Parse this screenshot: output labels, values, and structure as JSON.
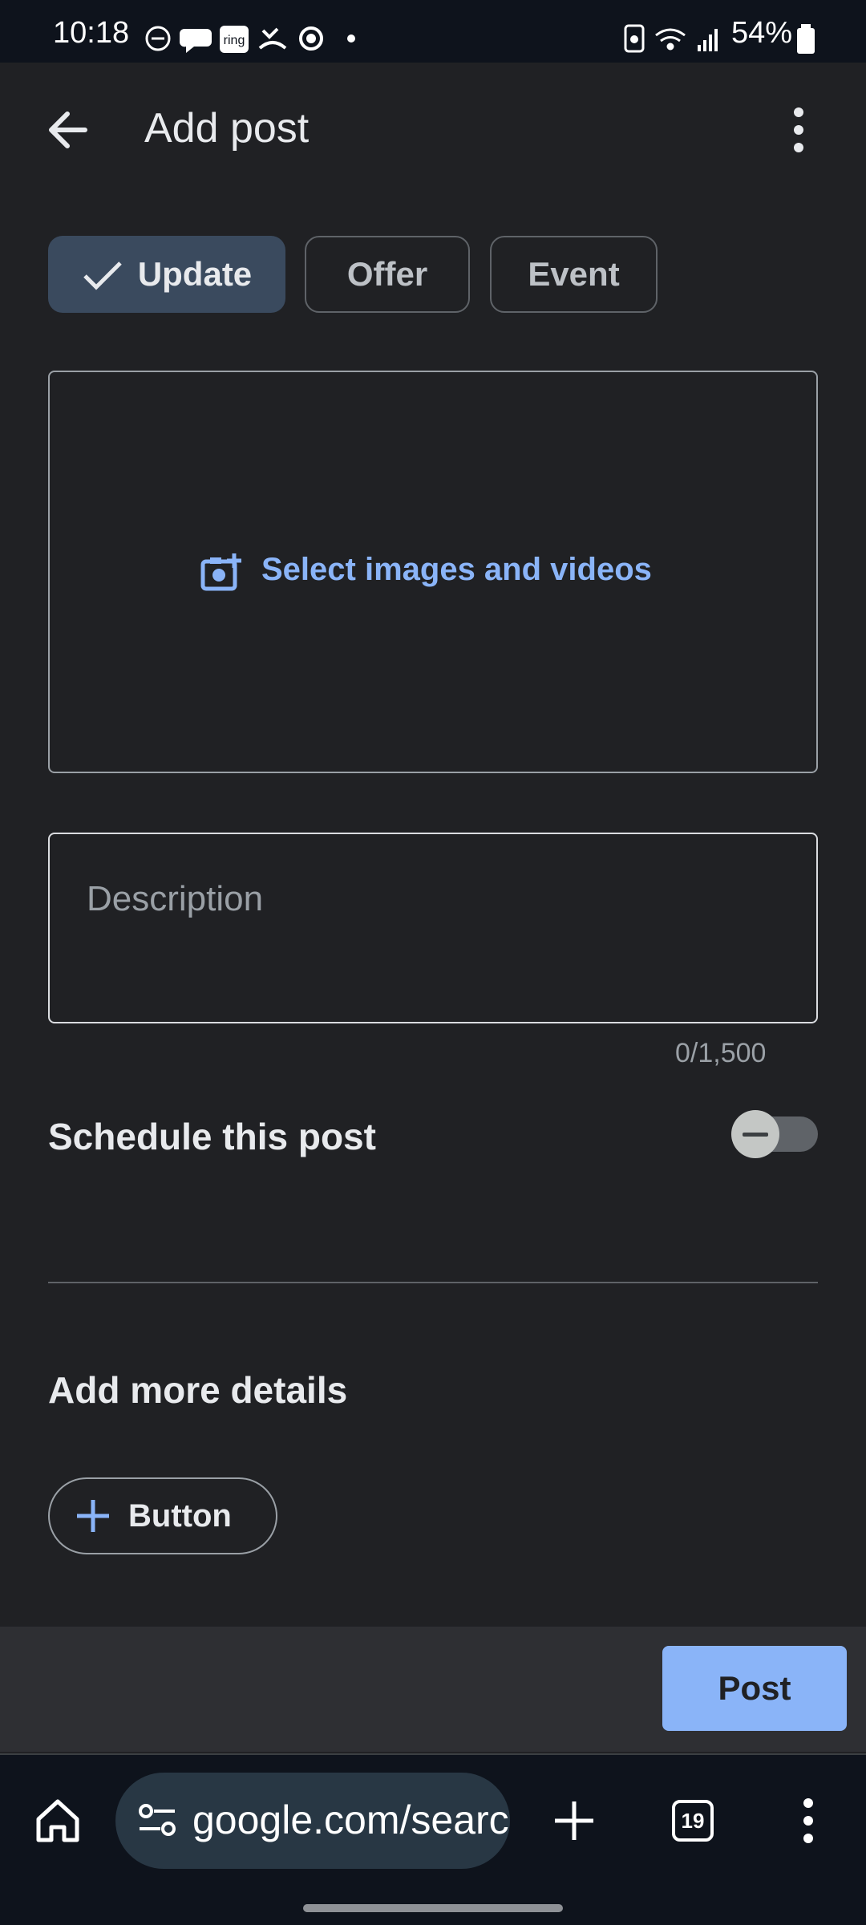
{
  "status_bar": {
    "time": "10:18",
    "battery": "54%",
    "icons": [
      "do-not-disturb-icon",
      "chat-icon",
      "ring-icon",
      "missed-call-icon",
      "sync-icon",
      "dot-icon",
      "battery-saver-icon",
      "wifi-icon",
      "signal-icon",
      "battery-icon"
    ],
    "ring_label": "ring"
  },
  "app_bar": {
    "title": "Add post"
  },
  "post_types": {
    "selected": "Update",
    "chips": [
      "Update",
      "Offer",
      "Event"
    ]
  },
  "media": {
    "label": "Select images and videos"
  },
  "description": {
    "placeholder": "Description",
    "counter": "0/1,500"
  },
  "schedule": {
    "label": "Schedule this post",
    "enabled": false
  },
  "details": {
    "heading": "Add more details",
    "button_label": "Button"
  },
  "actions": {
    "post_label": "Post"
  },
  "browser": {
    "url": "google.com/search",
    "tab_count": "19"
  },
  "colors": {
    "accent": "#8ab4f8",
    "background": "#202124",
    "selected_chip": "#3a4a5e"
  }
}
